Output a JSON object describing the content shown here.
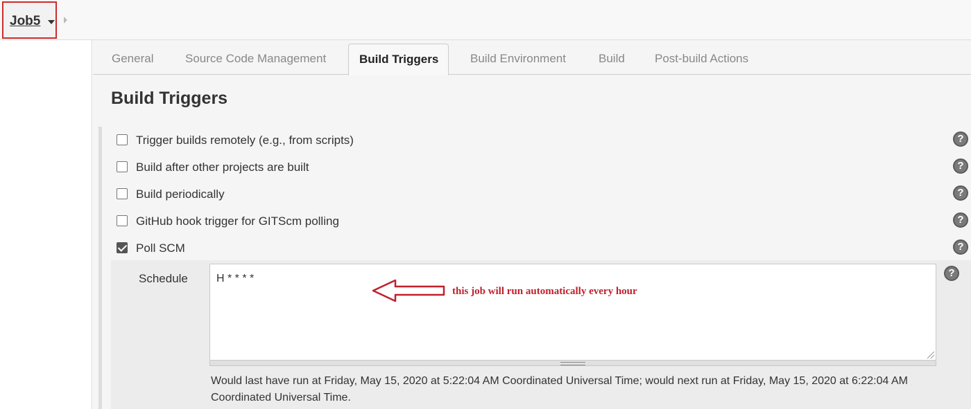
{
  "breadcrumb": {
    "job_name": "Job5"
  },
  "tabs": [
    {
      "label": "General"
    },
    {
      "label": "Source Code Management"
    },
    {
      "label": "Build Triggers",
      "active": true
    },
    {
      "label": "Build Environment"
    },
    {
      "label": "Build"
    },
    {
      "label": "Post-build Actions"
    }
  ],
  "section": {
    "title": "Build Triggers"
  },
  "triggers": [
    {
      "label": "Trigger builds remotely (e.g., from scripts)",
      "checked": false
    },
    {
      "label": "Build after other projects are built",
      "checked": false
    },
    {
      "label": "Build periodically",
      "checked": false
    },
    {
      "label": "GitHub hook trigger for GITScm polling",
      "checked": false
    },
    {
      "label": "Poll SCM",
      "checked": true
    }
  ],
  "poll_scm": {
    "schedule_label": "Schedule",
    "schedule_value": "H * * * *",
    "annotation": "this job will run automatically every hour",
    "annotation_color": "#c0202c",
    "note": "Would last have run at Friday, May 15, 2020 at 5:22:04 AM Coordinated Universal Time; would next run at Friday, May 15, 2020 at 6:22:04 AM Coordinated Universal Time."
  },
  "icons": {
    "help": "question-mark-circle-icon",
    "dropdown": "caret-down-icon",
    "breadcrumb_separator": "chevron-right-icon",
    "annotation_arrow": "left-arrow-icon"
  },
  "help_glyph": "?",
  "colors": {
    "highlight_border": "#cc2b2b",
    "accent_text": "#c0202c"
  }
}
